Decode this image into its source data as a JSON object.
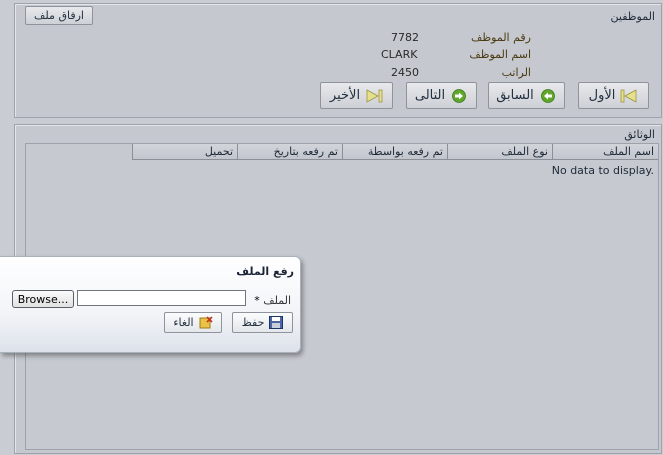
{
  "employee_panel": {
    "title": "الموظفين",
    "attach_button": "ارفاق ملف",
    "fields": [
      {
        "label": "رقم الموظف",
        "value": "7782"
      },
      {
        "label": "اسم الموظف",
        "value": "CLARK"
      },
      {
        "label": "الراتب",
        "value": "2450"
      }
    ],
    "nav": {
      "first": "الأول",
      "previous": "السابق",
      "next": "التالى",
      "last": "الأخير"
    }
  },
  "documents_panel": {
    "title": "الوثائق",
    "columns": [
      "اسم الملف",
      "نوع الملف",
      "تم رفعه بواسطة",
      "تم رفعه بتاريخ",
      "تحميل"
    ],
    "empty_text": "No data to display."
  },
  "upload_dialog": {
    "title": "رفع الملف",
    "file_label": "الملف",
    "required_mark": "*",
    "file_value": "",
    "browse_label": "Browse...",
    "save_label": "حفظ",
    "cancel_label": "الغاء"
  },
  "colors": {
    "background": "#c9ccd2",
    "nav_icon_green": "#5fa62b",
    "nav_icon_yellow": "#e7e08a"
  }
}
